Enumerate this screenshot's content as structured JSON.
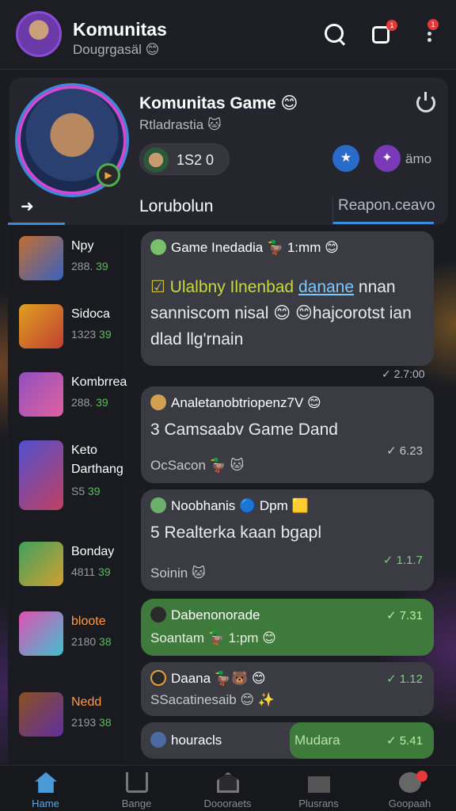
{
  "header": {
    "title": "Komunitas",
    "subtitle": "Dougrgasäl 😊"
  },
  "notifications": {
    "count": "1"
  },
  "more": {
    "count": "1"
  },
  "hero": {
    "title": "Komunitas Game 😊",
    "subtitle": "Rtladrastia 🐱",
    "stat_value": "1S2 0",
    "more_label": "ämo"
  },
  "tabs": {
    "main": "Lorubolun",
    "right": "Reapon.ceavo"
  },
  "sidebar": {
    "items": [
      {
        "name": "Npy",
        "count": "288.",
        "count_suffix": "39"
      },
      {
        "name": "Sidoca",
        "count": "1323",
        "count_suffix": "39"
      },
      {
        "name": "Kombrrea",
        "count": "288.",
        "count_suffix": "39"
      },
      {
        "name": "Keto",
        "name2": "Darthang",
        "count": "S5",
        "count_suffix": "39"
      },
      {
        "name": "Bonday",
        "count": "4811",
        "count_suffix": "39"
      },
      {
        "name": "bloote",
        "count": "2180",
        "count_suffix": "38"
      },
      {
        "name": "Nedd",
        "count": "2193",
        "count_suffix": "38"
      }
    ]
  },
  "posts": [
    {
      "author": "Game Inedadia 🦆 1:mm 😊",
      "text_prefix": "☑",
      "text_a": "Ulalbny Ilnenbad",
      "text_link": "danane",
      "text_b": "nnan sanniscom nisal 😊 😊hajcorotst ian dlad llg'rnain",
      "time": "✓ 2.7:00"
    },
    {
      "author": "Analetanobtriopenz7V 😊",
      "text": "3  Camsaabv Game Dand",
      "foot": "OcSacon 🦆 🐱",
      "time": "✓ 6.23"
    },
    {
      "author": "Noobhanis 🔵 Dpm 🟨",
      "text": "5  Realterka kaan bgapl",
      "foot": "Soinin 🐱",
      "time": "✓ 1.1.7"
    },
    {
      "author": "Dabenonorade",
      "foot": "Soantam 🦆 1:pm 😊",
      "time": "✓ 7.31"
    },
    {
      "author": "Daana 🦆🐻 😊",
      "foot": "SSacatinesaib 😊 ✨",
      "time": "✓ 1.12"
    },
    {
      "author": "houracls",
      "green_label": "Mudara",
      "time": "✓ 5.41"
    }
  ],
  "bottom_nav": [
    {
      "label": "Hame"
    },
    {
      "label": "Bange"
    },
    {
      "label": "Doooraets"
    },
    {
      "label": "Plusrans"
    },
    {
      "label": "Goopaah"
    }
  ]
}
